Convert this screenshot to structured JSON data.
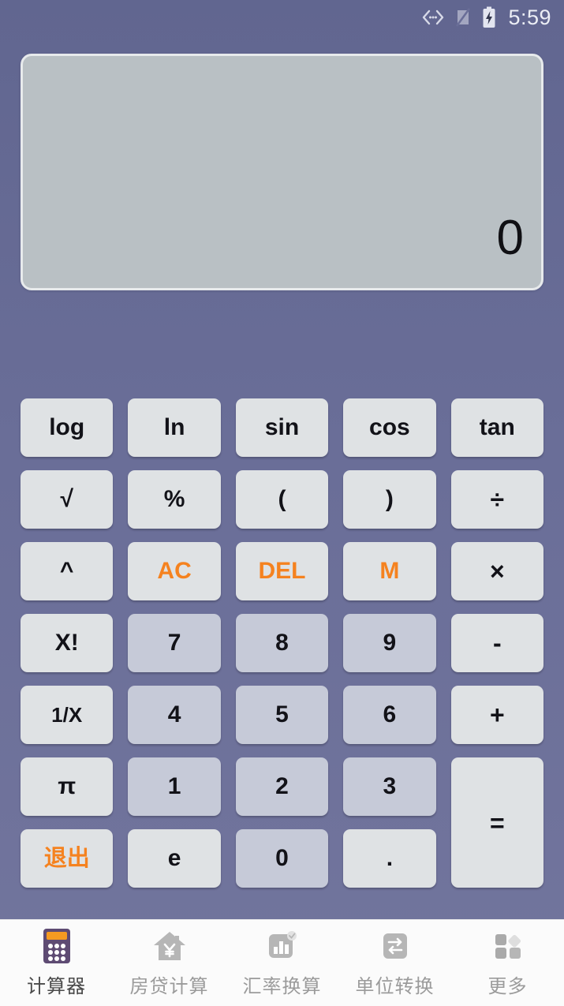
{
  "statusbar": {
    "time": "5:59",
    "icons": [
      "bluetooth-data-icon",
      "signal-off-icon",
      "battery-charging-icon"
    ]
  },
  "display": {
    "value": "0"
  },
  "colors": {
    "background_top": "#616690",
    "background_bottom": "#72759d",
    "display_bg": "#b9c0c4",
    "key_function": "#dfe2e4",
    "key_number": "#c6cad8",
    "accent": "#f5821f",
    "nav_bg": "#fbfbfb",
    "nav_label": "#9b9b9b",
    "nav_label_active": "#4a4a4a"
  },
  "keypad": {
    "keys": [
      {
        "label": "log",
        "name": "key-log",
        "style": "fn"
      },
      {
        "label": "ln",
        "name": "key-ln",
        "style": "fn"
      },
      {
        "label": "sin",
        "name": "key-sin",
        "style": "fn"
      },
      {
        "label": "cos",
        "name": "key-cos",
        "style": "fn"
      },
      {
        "label": "tan",
        "name": "key-tan",
        "style": "fn"
      },
      {
        "label": "√",
        "name": "key-sqrt",
        "style": "fn"
      },
      {
        "label": "%",
        "name": "key-percent",
        "style": "fn"
      },
      {
        "label": "(",
        "name": "key-paren-open",
        "style": "fn"
      },
      {
        "label": ")",
        "name": "key-paren-close",
        "style": "fn"
      },
      {
        "label": "÷",
        "name": "key-divide",
        "style": "op"
      },
      {
        "label": "^",
        "name": "key-power",
        "style": "fn"
      },
      {
        "label": "AC",
        "name": "key-all-clear",
        "style": "accent"
      },
      {
        "label": "DEL",
        "name": "key-delete",
        "style": "accent"
      },
      {
        "label": "M",
        "name": "key-memory",
        "style": "accent"
      },
      {
        "label": "×",
        "name": "key-multiply",
        "style": "op"
      },
      {
        "label": "X!",
        "name": "key-factorial",
        "style": "fn"
      },
      {
        "label": "7",
        "name": "key-7",
        "style": "num"
      },
      {
        "label": "8",
        "name": "key-8",
        "style": "num"
      },
      {
        "label": "9",
        "name": "key-9",
        "style": "num"
      },
      {
        "label": "-",
        "name": "key-minus",
        "style": "op"
      },
      {
        "label": "1/X",
        "name": "key-reciprocal",
        "style": "small"
      },
      {
        "label": "4",
        "name": "key-4",
        "style": "num"
      },
      {
        "label": "5",
        "name": "key-5",
        "style": "num"
      },
      {
        "label": "6",
        "name": "key-6",
        "style": "num"
      },
      {
        "label": "+",
        "name": "key-plus",
        "style": "op"
      },
      {
        "label": "π",
        "name": "key-pi",
        "style": "fn"
      },
      {
        "label": "1",
        "name": "key-1",
        "style": "num"
      },
      {
        "label": "2",
        "name": "key-2",
        "style": "num"
      },
      {
        "label": "3",
        "name": "key-3",
        "style": "num"
      },
      {
        "label": "=",
        "name": "key-equals",
        "style": "tall"
      },
      {
        "label": "退出",
        "name": "key-exit",
        "style": "accent-cjk"
      },
      {
        "label": "e",
        "name": "key-e",
        "style": "fn"
      },
      {
        "label": "0",
        "name": "key-0",
        "style": "num"
      },
      {
        "label": ".",
        "name": "key-decimal",
        "style": "fn"
      }
    ]
  },
  "bottomnav": {
    "items": [
      {
        "label": "计算器",
        "name": "nav-calculator",
        "icon": "calculator-icon",
        "active": true
      },
      {
        "label": "房贷计算",
        "name": "nav-mortgage",
        "icon": "house-yen-icon",
        "active": false
      },
      {
        "label": "汇率换算",
        "name": "nav-exchange-rate",
        "icon": "bar-chart-icon",
        "active": false
      },
      {
        "label": "单位转换",
        "name": "nav-unit-conversion",
        "icon": "exchange-arrows-icon",
        "active": false
      },
      {
        "label": "更多",
        "name": "nav-more",
        "icon": "grid-more-icon",
        "active": false
      }
    ]
  }
}
